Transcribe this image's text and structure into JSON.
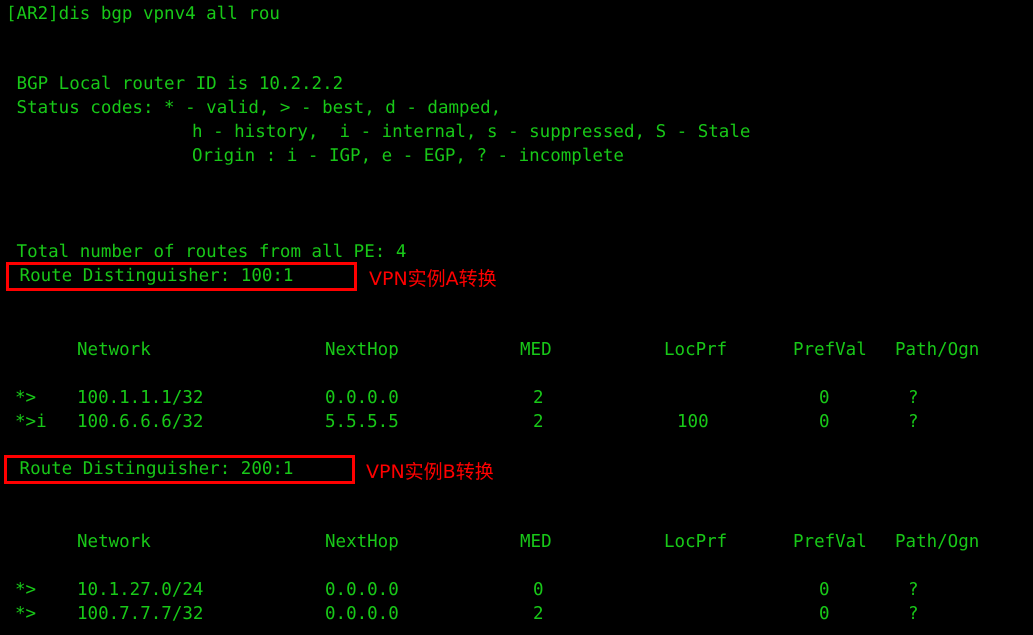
{
  "terminal": {
    "theme": {
      "background": "#000000",
      "foreground": "#18c818",
      "annotation": "#ff0000"
    },
    "prompt_line": "[AR2]dis bgp vpnv4 all rou",
    "header": {
      "router_id_line": " BGP Local router ID is 10.2.2.2",
      "status_codes_line": " Status codes: * - valid, > - best, d - damped,",
      "status_codes_cont1": "h - history,  i - internal, s - suppressed, S - Stale",
      "status_codes_cont2": "Origin : i - IGP, e - EGP, ? - incomplete"
    },
    "total_routes_line": " Total number of routes from all PE: 4",
    "columns": {
      "network": "Network",
      "nexthop": "NextHop",
      "med": "MED",
      "locprf": "LocPrf",
      "prefval": "PrefVal",
      "path_ogn": "Path/Ogn"
    },
    "sections": [
      {
        "rd_label": " Route Distinguisher: 100:1",
        "annotation": "VPN实例A转换",
        "rows": [
          {
            "status": "*>",
            "network": "100.1.1.1/32",
            "nexthop": "0.0.0.0",
            "med": "2",
            "locprf": "",
            "prefval": "0",
            "path_ogn": "?"
          },
          {
            "status": "*>i",
            "network": "100.6.6.6/32",
            "nexthop": "5.5.5.5",
            "med": "2",
            "locprf": "100",
            "prefval": "0",
            "path_ogn": "?"
          }
        ]
      },
      {
        "rd_label": " Route Distinguisher: 200:1",
        "annotation": "VPN实例B转换",
        "rows": [
          {
            "status": "*>",
            "network": "10.1.27.0/24",
            "nexthop": "0.0.0.0",
            "med": "0",
            "locprf": "",
            "prefval": "0",
            "path_ogn": "?"
          },
          {
            "status": "*>",
            "network": "100.7.7.7/32",
            "nexthop": "0.0.0.0",
            "med": "2",
            "locprf": "",
            "prefval": "0",
            "path_ogn": "?"
          }
        ]
      }
    ]
  }
}
